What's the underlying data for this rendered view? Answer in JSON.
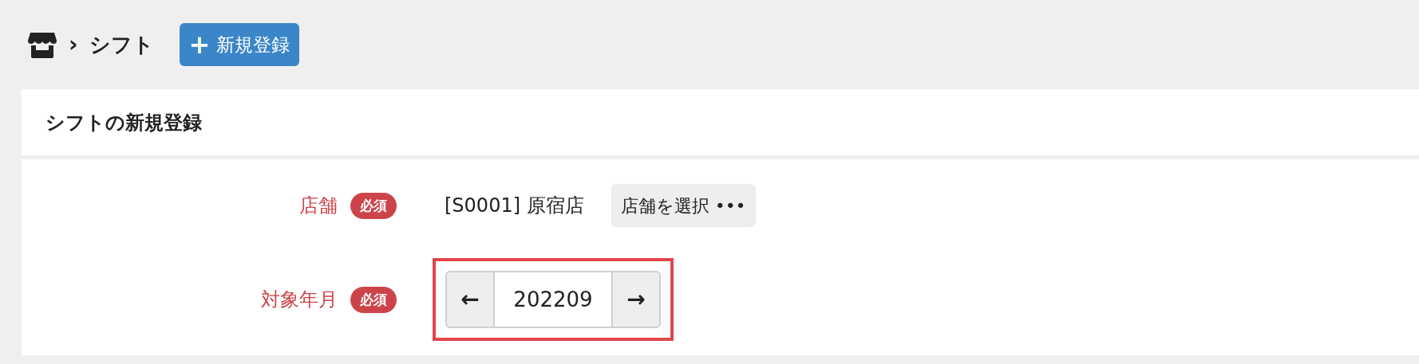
{
  "breadcrumb": {
    "separator": "›",
    "current": "シフト"
  },
  "new_button": {
    "icon": "+",
    "label": "新規登録"
  },
  "card": {
    "title": "シフトの新規登録",
    "fields": [
      {
        "kind": "store",
        "label": "店舗",
        "badge": "必須",
        "value": "[S0001] 原宿店",
        "button": "店舗を選択 •••"
      },
      {
        "kind": "month",
        "label": "対象年月",
        "badge": "必須",
        "prev": "←",
        "value": "202209",
        "next": "→",
        "highlighted": true
      }
    ]
  }
}
